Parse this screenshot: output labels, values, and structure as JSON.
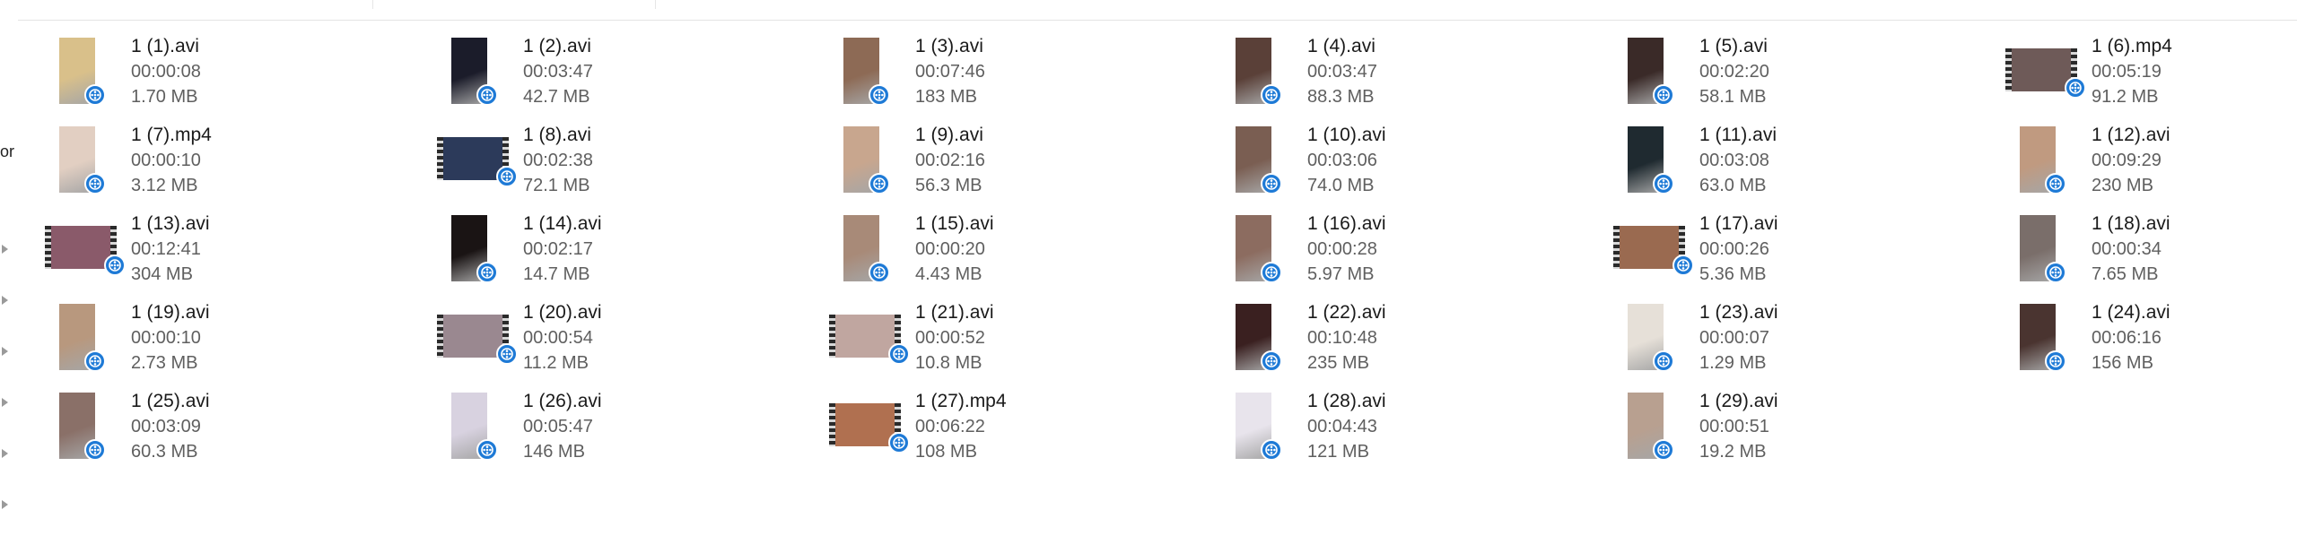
{
  "colors": {
    "badge": "#1e7ad6",
    "text": "#1a1a1a",
    "meta": "#5f5f5f"
  },
  "left_strip_text": "or",
  "icons": {
    "file_badge": "film-reel-icon",
    "pin": "pin-icon"
  },
  "files": [
    {
      "name": "1 (1).avi",
      "duration": "00:00:08",
      "size": "1.70 MB",
      "thumb": "portrait",
      "color": "#d9c08a"
    },
    {
      "name": "1 (2).avi",
      "duration": "00:03:47",
      "size": "42.7 MB",
      "thumb": "portrait",
      "color": "#1b1c2a"
    },
    {
      "name": "1 (3).avi",
      "duration": "00:07:46",
      "size": "183 MB",
      "thumb": "portrait",
      "color": "#8d6a55"
    },
    {
      "name": "1 (4).avi",
      "duration": "00:03:47",
      "size": "88.3 MB",
      "thumb": "portrait",
      "color": "#5a4038"
    },
    {
      "name": "1 (5).avi",
      "duration": "00:02:20",
      "size": "58.1 MB",
      "thumb": "portrait",
      "color": "#3a2a28"
    },
    {
      "name": "1 (6).mp4",
      "duration": "00:05:19",
      "size": "91.2 MB",
      "thumb": "landscape",
      "color": "#6e5a58"
    },
    {
      "name": "1 (7).mp4",
      "duration": "00:00:10",
      "size": "3.12 MB",
      "thumb": "portrait",
      "color": "#e2cfc2"
    },
    {
      "name": "1 (8).avi",
      "duration": "00:02:38",
      "size": "72.1 MB",
      "thumb": "landscape",
      "color": "#2c3a5a"
    },
    {
      "name": "1 (9).avi",
      "duration": "00:02:16",
      "size": "56.3 MB",
      "thumb": "portrait",
      "color": "#c8a68e"
    },
    {
      "name": "1 (10).avi",
      "duration": "00:03:06",
      "size": "74.0 MB",
      "thumb": "portrait",
      "color": "#7a5e52"
    },
    {
      "name": "1 (11).avi",
      "duration": "00:03:08",
      "size": "63.0 MB",
      "thumb": "portrait",
      "color": "#1f2a30"
    },
    {
      "name": "1 (12).avi",
      "duration": "00:09:29",
      "size": "230 MB",
      "thumb": "portrait",
      "color": "#c09a80"
    },
    {
      "name": "1 (13).avi",
      "duration": "00:12:41",
      "size": "304 MB",
      "thumb": "landscape",
      "color": "#8a5a6a"
    },
    {
      "name": "1 (14).avi",
      "duration": "00:02:17",
      "size": "14.7 MB",
      "thumb": "portrait",
      "color": "#1a1414"
    },
    {
      "name": "1 (15).avi",
      "duration": "00:00:20",
      "size": "4.43 MB",
      "thumb": "portrait",
      "color": "#a88a78"
    },
    {
      "name": "1 (16).avi",
      "duration": "00:00:28",
      "size": "5.97 MB",
      "thumb": "portrait",
      "color": "#8c6c60"
    },
    {
      "name": "1 (17).avi",
      "duration": "00:00:26",
      "size": "5.36 MB",
      "thumb": "landscape",
      "color": "#9a6a50"
    },
    {
      "name": "1 (18).avi",
      "duration": "00:00:34",
      "size": "7.65 MB",
      "thumb": "portrait",
      "color": "#7a6e6a"
    },
    {
      "name": "1 (19).avi",
      "duration": "00:00:10",
      "size": "2.73 MB",
      "thumb": "portrait",
      "color": "#b8987e"
    },
    {
      "name": "1 (20).avi",
      "duration": "00:00:54",
      "size": "11.2 MB",
      "thumb": "landscape",
      "color": "#9a8890"
    },
    {
      "name": "1 (21).avi",
      "duration": "00:00:52",
      "size": "10.8 MB",
      "thumb": "landscape",
      "color": "#c0a6a0"
    },
    {
      "name": "1 (22).avi",
      "duration": "00:10:48",
      "size": "235 MB",
      "thumb": "portrait",
      "color": "#3a2020"
    },
    {
      "name": "1 (23).avi",
      "duration": "00:00:07",
      "size": "1.29 MB",
      "thumb": "portrait",
      "color": "#e6e0d8"
    },
    {
      "name": "1 (24).avi",
      "duration": "00:06:16",
      "size": "156 MB",
      "thumb": "portrait",
      "color": "#4a3430"
    },
    {
      "name": "1 (25).avi",
      "duration": "00:03:09",
      "size": "60.3 MB",
      "thumb": "portrait",
      "color": "#8a7068"
    },
    {
      "name": "1 (26).avi",
      "duration": "00:05:47",
      "size": "146 MB",
      "thumb": "portrait",
      "color": "#d8d2e0"
    },
    {
      "name": "1 (27).mp4",
      "duration": "00:06:22",
      "size": "108 MB",
      "thumb": "landscape",
      "color": "#b07050"
    },
    {
      "name": "1 (28).avi",
      "duration": "00:04:43",
      "size": "121 MB",
      "thumb": "portrait",
      "color": "#e8e4ec"
    },
    {
      "name": "1 (29).avi",
      "duration": "00:00:51",
      "size": "19.2 MB",
      "thumb": "portrait",
      "color": "#b8a090"
    }
  ]
}
